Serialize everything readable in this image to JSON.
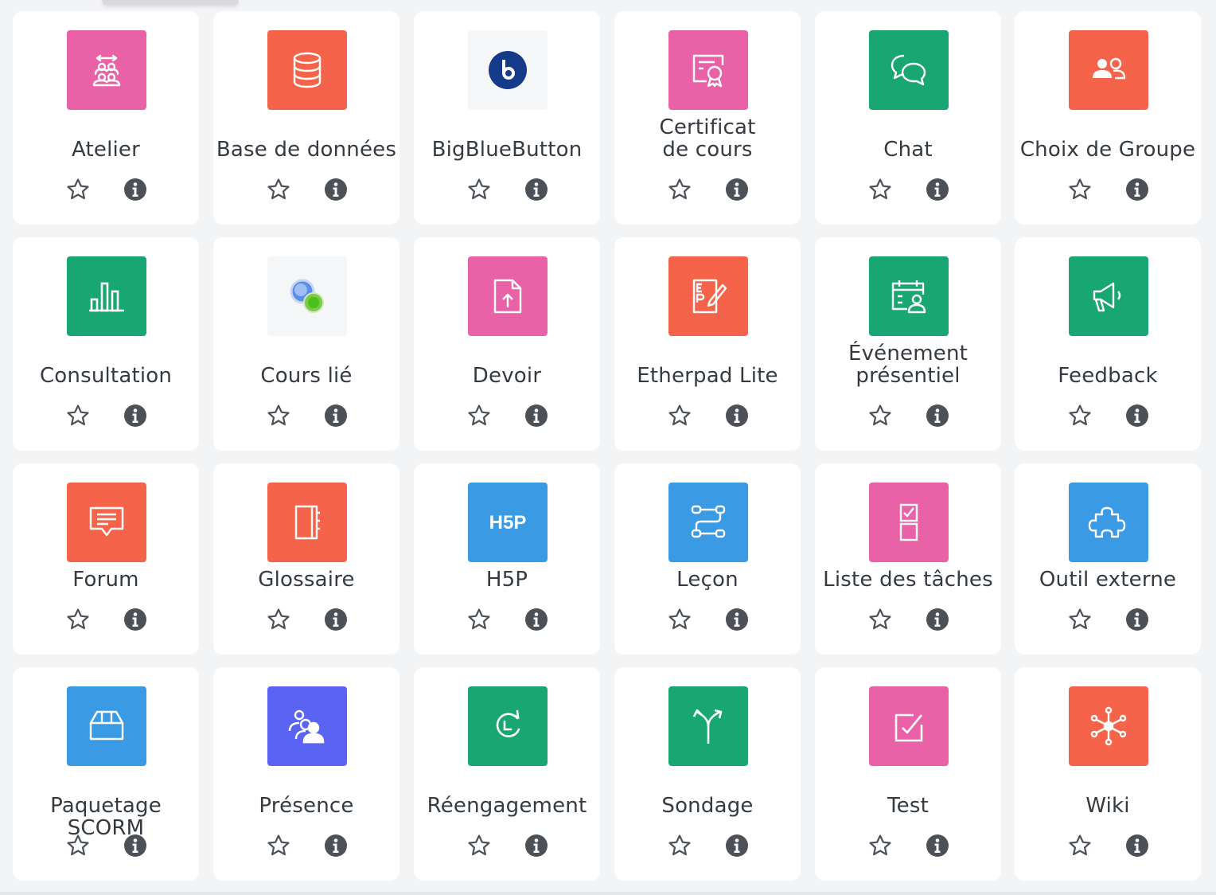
{
  "colors": {
    "pink": "#e961a6",
    "orange": "#f5644a",
    "green": "#18a672",
    "blue": "#3a9ae3",
    "purple": "#5b63f2",
    "light": "#f4f6f8",
    "action_icon": "#4b5157"
  },
  "activities": [
    {
      "label": "Atelier",
      "icon": "workshop-icon",
      "tile": "pink"
    },
    {
      "label": "Base de données",
      "icon": "database-icon",
      "tile": "orange"
    },
    {
      "label": "BigBlueButton",
      "icon": "bigbluebutton-icon",
      "tile": "light"
    },
    {
      "label": "Certificat de cours",
      "icon": "certificate-icon",
      "tile": "pink"
    },
    {
      "label": "Chat",
      "icon": "chat-icon",
      "tile": "green"
    },
    {
      "label": "Choix de Groupe",
      "icon": "group-choice-icon",
      "tile": "orange"
    },
    {
      "label": "Consultation",
      "icon": "bar-chart-icon",
      "tile": "green"
    },
    {
      "label": "Cours lié",
      "icon": "linked-course-icon",
      "tile": "light"
    },
    {
      "label": "Devoir",
      "icon": "assignment-upload-icon",
      "tile": "pink"
    },
    {
      "label": "Etherpad Lite",
      "icon": "etherpad-icon",
      "tile": "orange"
    },
    {
      "label": "Événement présentiel",
      "icon": "calendar-person-icon",
      "tile": "green"
    },
    {
      "label": "Feedback",
      "icon": "megaphone-icon",
      "tile": "green"
    },
    {
      "label": "Forum",
      "icon": "forum-icon",
      "tile": "orange"
    },
    {
      "label": "Glossaire",
      "icon": "glossary-book-icon",
      "tile": "orange"
    },
    {
      "label": "H5P",
      "icon": "h5p-icon",
      "tile": "blue"
    },
    {
      "label": "Leçon",
      "icon": "lesson-path-icon",
      "tile": "blue"
    },
    {
      "label": "Liste des tâches",
      "icon": "checklist-icon",
      "tile": "pink"
    },
    {
      "label": "Outil externe",
      "icon": "puzzle-icon",
      "tile": "blue"
    },
    {
      "label": "Paquetage SCORM",
      "icon": "package-box-icon",
      "tile": "blue"
    },
    {
      "label": "Présence",
      "icon": "attendance-people-icon",
      "tile": "purple"
    },
    {
      "label": "Réengagement",
      "icon": "reengagement-clock-icon",
      "tile": "green"
    },
    {
      "label": "Sondage",
      "icon": "signpost-arrows-icon",
      "tile": "green"
    },
    {
      "label": "Test",
      "icon": "quiz-check-icon",
      "tile": "pink"
    },
    {
      "label": "Wiki",
      "icon": "wiki-network-icon",
      "tile": "orange"
    }
  ]
}
